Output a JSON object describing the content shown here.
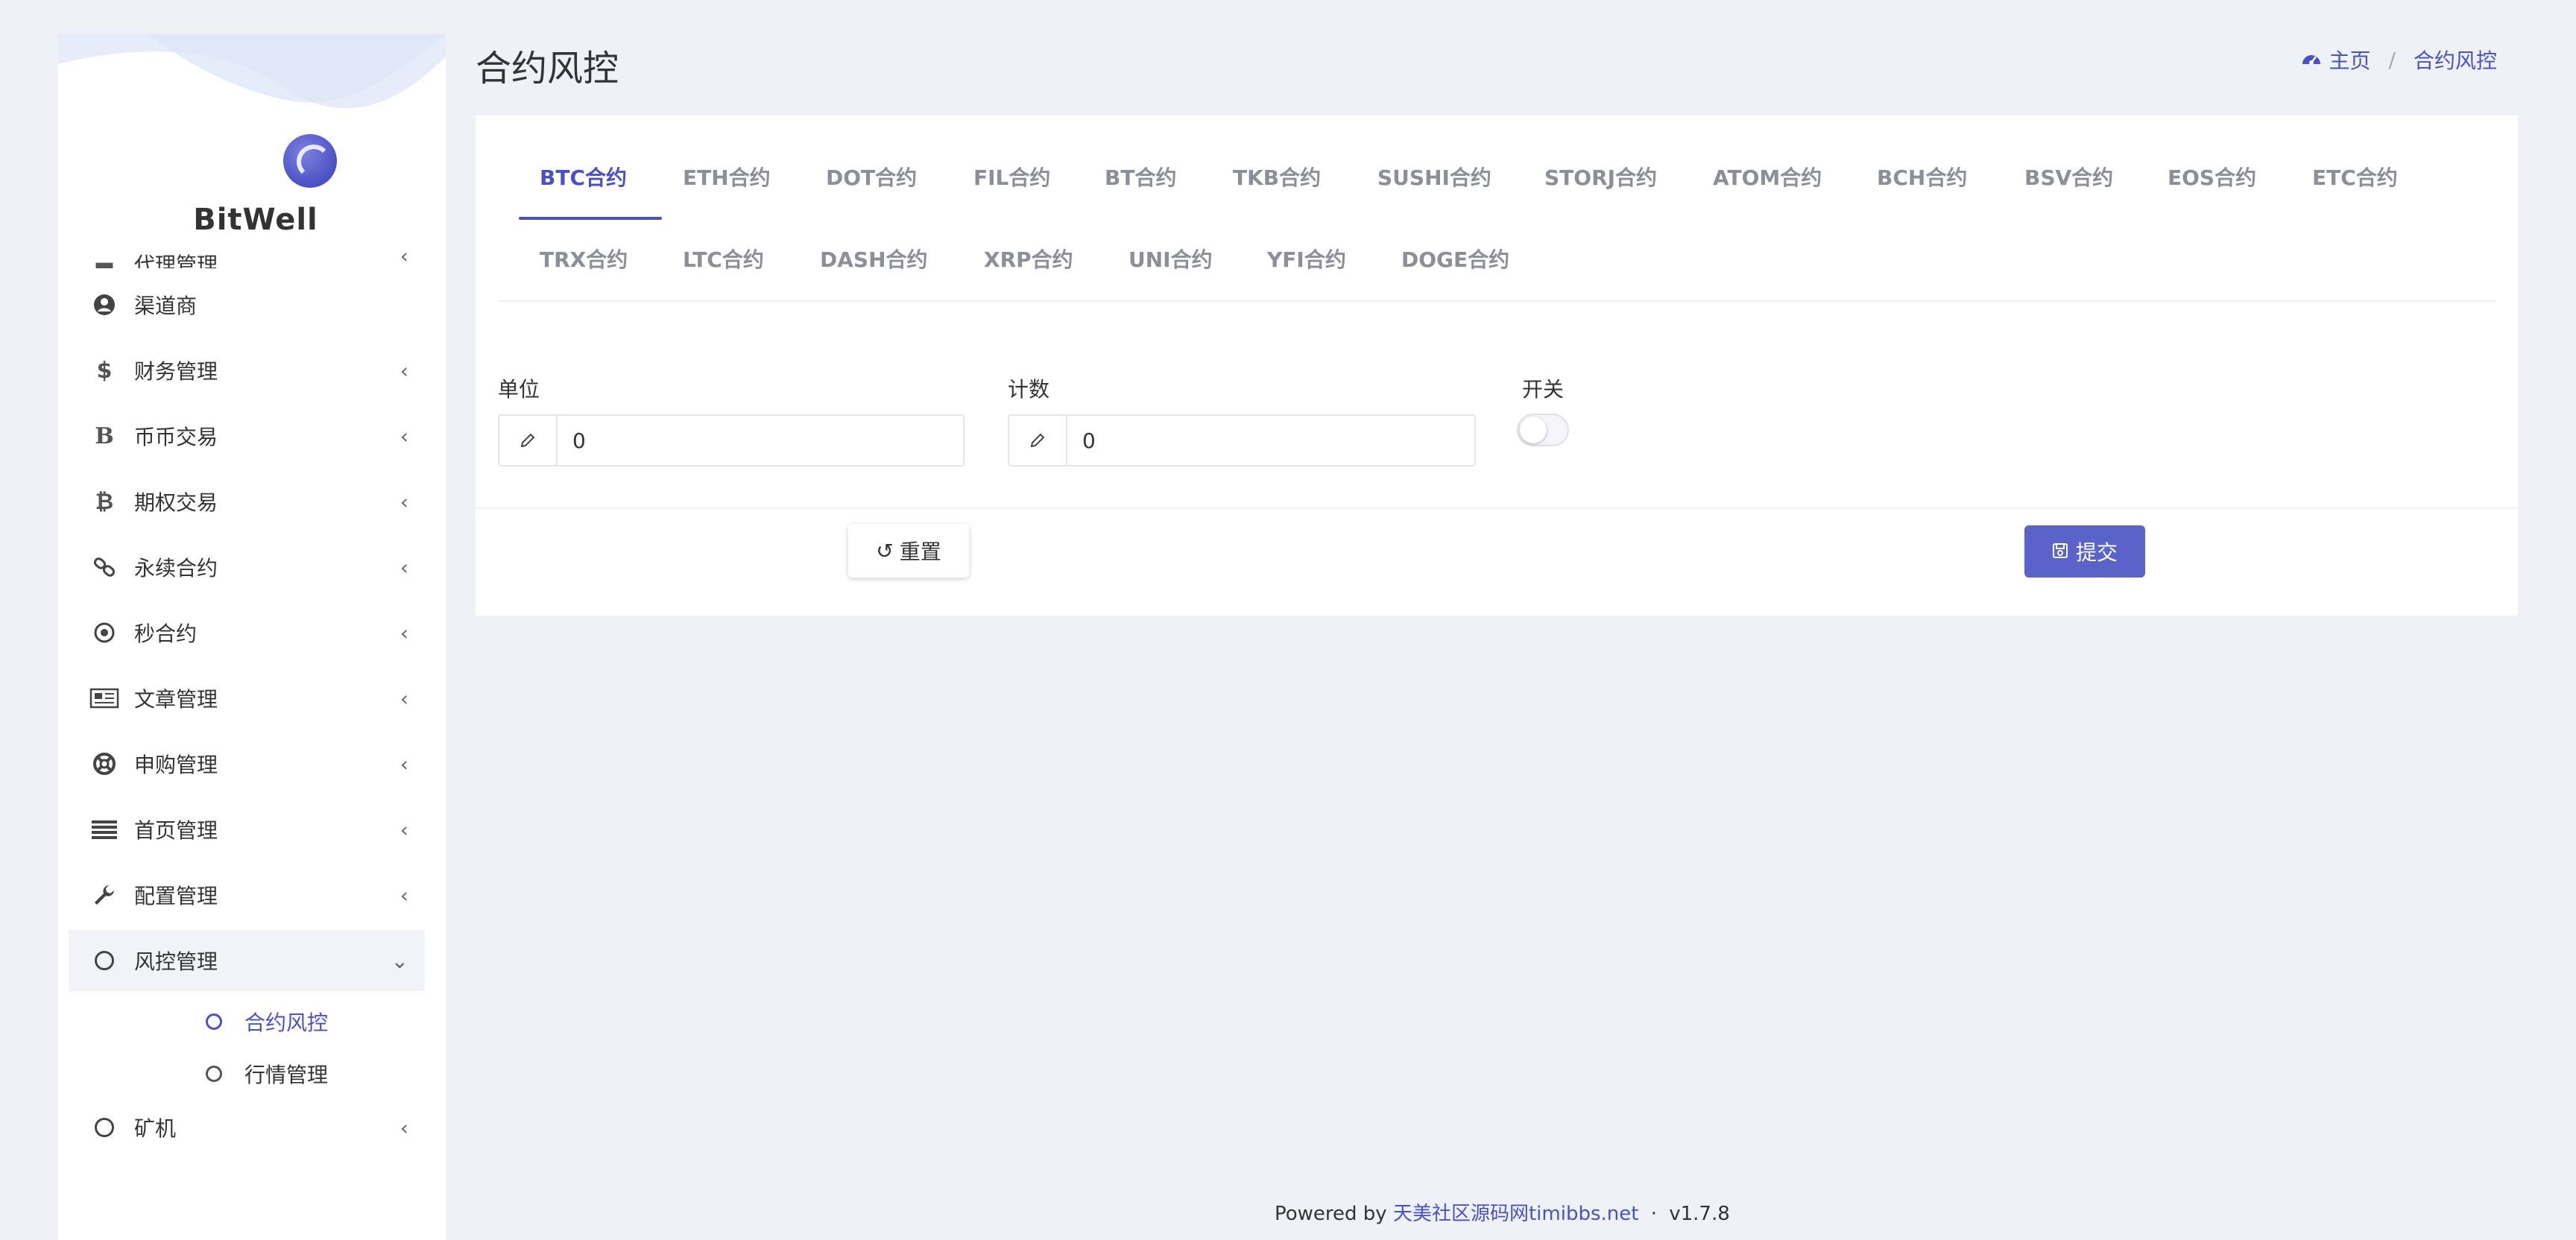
{
  "sidebar": {
    "brand": "BitWell",
    "items": [
      {
        "label": "代理管理",
        "icon": "agent-icon"
      },
      {
        "label": "渠道商",
        "icon": "user-circle-icon"
      },
      {
        "label": "财务管理",
        "icon": "dollar-icon"
      },
      {
        "label": "币币交易",
        "icon": "b-icon"
      },
      {
        "label": "期权交易",
        "icon": "bitcoin-icon"
      },
      {
        "label": "永续合约",
        "icon": "link-icon"
      },
      {
        "label": "秒合约",
        "icon": "dot-circle-icon"
      },
      {
        "label": "文章管理",
        "icon": "newspaper-icon"
      },
      {
        "label": "申购管理",
        "icon": "lifebuoy-icon"
      },
      {
        "label": "首页管理",
        "icon": "list-icon"
      },
      {
        "label": "配置管理",
        "icon": "wrench-icon"
      },
      {
        "label": "风控管理",
        "icon": "circle-icon"
      },
      {
        "label": "矿机",
        "icon": "circle-icon"
      }
    ],
    "subitems": [
      {
        "label": "合约风控"
      },
      {
        "label": "行情管理"
      }
    ]
  },
  "header": {
    "title": "合约风控",
    "breadcrumb": {
      "home": "主页",
      "current": "合约风控"
    }
  },
  "tabs": [
    "BTC合约",
    "ETH合约",
    "DOT合约",
    "FIL合约",
    "BT合约",
    "TKB合约",
    "SUSHI合约",
    "STORJ合约",
    "ATOM合约",
    "BCH合约",
    "BSV合约",
    "EOS合约",
    "ETC合约",
    "TRX合约",
    "LTC合约",
    "DASH合约",
    "XRP合约",
    "UNI合约",
    "YFI合约",
    "DOGE合约"
  ],
  "active_tab": "BTC合约",
  "form": {
    "unit_label": "单位",
    "unit_value": "0",
    "count_label": "计数",
    "count_value": "0",
    "switch_label": "开关",
    "switch_on": false
  },
  "buttons": {
    "reset": "重置",
    "submit": "提交"
  },
  "footer": {
    "powered": "Powered by",
    "link": "天美社区源码网timibbs.net",
    "sep": "·",
    "version": "v1.7.8"
  },
  "colors": {
    "accent": "#4a51c4",
    "button": "#5a63c8",
    "background": "#eef1f6"
  }
}
